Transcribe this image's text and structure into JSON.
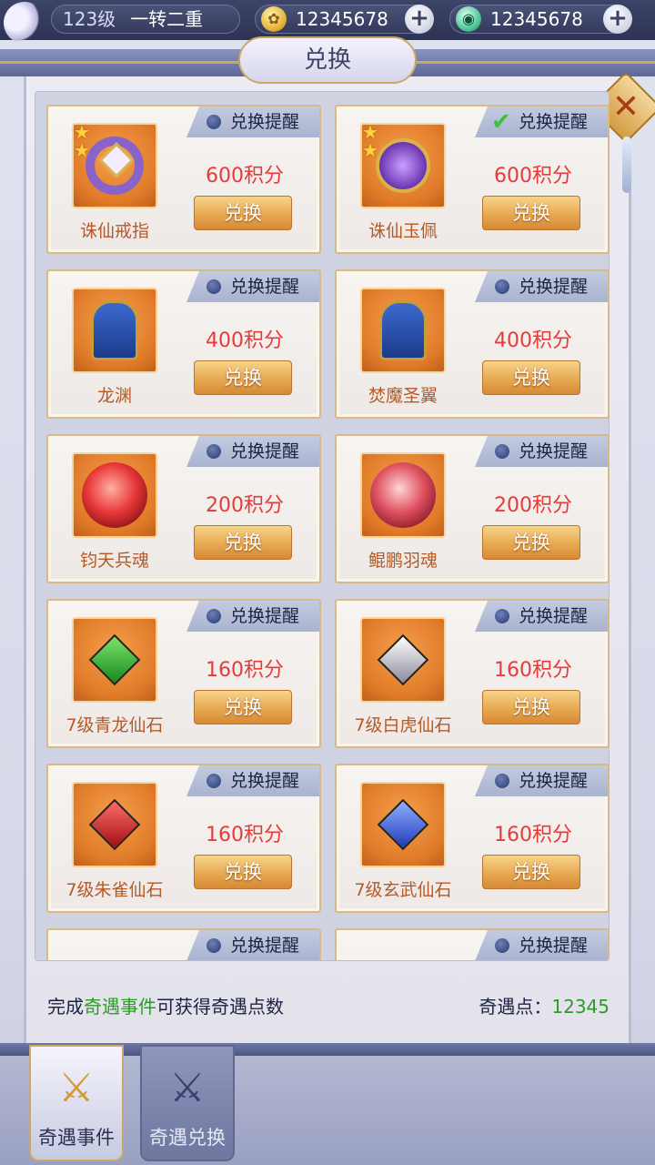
{
  "header": {
    "level": "123级",
    "realm": "一转二重",
    "currency1": {
      "icon": "gold-coin-icon",
      "value": "12345678"
    },
    "currency2": {
      "icon": "jade-icon",
      "value": "12345678"
    }
  },
  "title": "兑换",
  "items": [
    {
      "name": "诛仙戒指",
      "price": "600积分",
      "button": "兑换",
      "remind": "兑换提醒",
      "checked": false,
      "stars": 2,
      "icon": "ring-icon"
    },
    {
      "name": "诛仙玉佩",
      "price": "600积分",
      "button": "兑换",
      "remind": "兑换提醒",
      "checked": true,
      "stars": 2,
      "icon": "jade-pendant-icon"
    },
    {
      "name": "龙渊",
      "price": "400积分",
      "button": "兑换",
      "remind": "兑换提醒",
      "checked": false,
      "stars": 0,
      "icon": "bell-icon"
    },
    {
      "name": "焚魔圣翼",
      "price": "400积分",
      "button": "兑换",
      "remind": "兑换提醒",
      "checked": false,
      "stars": 0,
      "icon": "bell-icon"
    },
    {
      "name": "钧天兵魂",
      "price": "200积分",
      "button": "兑换",
      "remind": "兑换提醒",
      "checked": false,
      "stars": 0,
      "icon": "weapon-soul-icon"
    },
    {
      "name": "鲲鹏羽魂",
      "price": "200积分",
      "button": "兑换",
      "remind": "兑换提醒",
      "checked": false,
      "stars": 0,
      "icon": "feather-soul-icon"
    },
    {
      "name": "7级青龙仙石",
      "price": "160积分",
      "button": "兑换",
      "remind": "兑换提醒",
      "checked": false,
      "stars": 0,
      "icon": "green-gem-icon"
    },
    {
      "name": "7级白虎仙石",
      "price": "160积分",
      "button": "兑换",
      "remind": "兑换提醒",
      "checked": false,
      "stars": 0,
      "icon": "white-gem-icon"
    },
    {
      "name": "7级朱雀仙石",
      "price": "160积分",
      "button": "兑换",
      "remind": "兑换提醒",
      "checked": false,
      "stars": 0,
      "icon": "red-gem-icon"
    },
    {
      "name": "7级玄武仙石",
      "price": "160积分",
      "button": "兑换",
      "remind": "兑换提醒",
      "checked": false,
      "stars": 0,
      "icon": "blue-gem-icon"
    },
    {
      "name": "",
      "price": "",
      "button": "",
      "remind": "兑换提醒",
      "checked": false,
      "stars": 0,
      "icon": ""
    },
    {
      "name": "",
      "price": "",
      "button": "",
      "remind": "兑换提醒",
      "checked": false,
      "stars": 0,
      "icon": ""
    }
  ],
  "footer": {
    "prefix": "完成",
    "highlight": "奇遇事件",
    "suffix": "可获得奇遇点数",
    "points_label": "奇遇点：",
    "points_value": "12345"
  },
  "tabs": [
    {
      "label": "奇遇事件",
      "icon": "crossed-swords-icon",
      "active": true
    },
    {
      "label": "奇遇兑换",
      "icon": "crossed-swords-icon",
      "active": false
    }
  ],
  "colors": {
    "accent_green": "#2f9a2a",
    "price_red": "#e53b3b",
    "button_orange": "#e8a852"
  }
}
